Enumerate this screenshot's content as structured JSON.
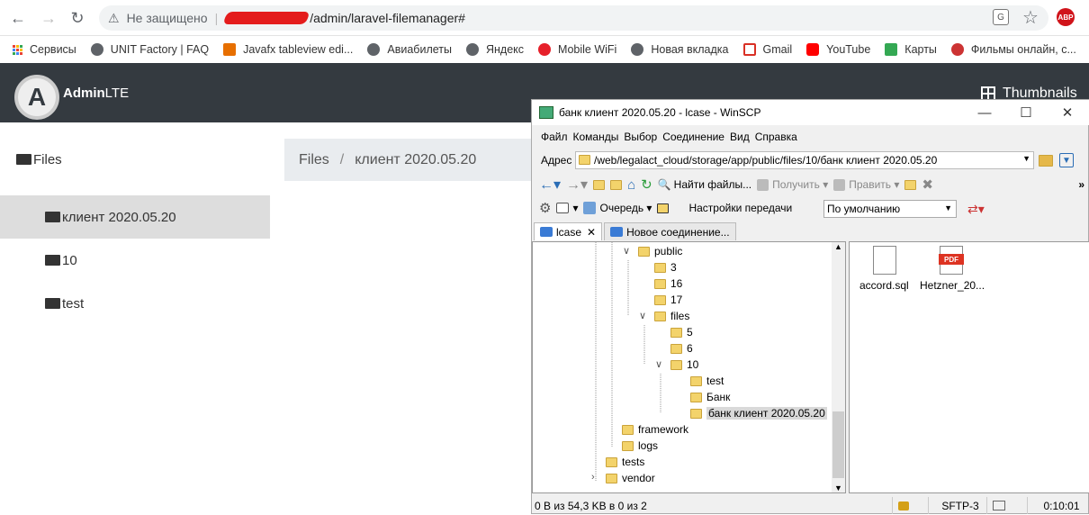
{
  "browser": {
    "security_label": "Не защищено",
    "url_suffix": "/admin/laravel-filemanager#",
    "translate_icon": "translate-icon",
    "star_icon": "star-icon",
    "abp_label": "ABP"
  },
  "bookmarks": [
    {
      "label": "Сервисы",
      "icon": "apps-icon"
    },
    {
      "label": "UNIT Factory | FAQ",
      "icon": "globe-icon"
    },
    {
      "label": "Javafx tableview edi...",
      "icon": "java-icon"
    },
    {
      "label": "Авиабилеты",
      "icon": "globe-icon"
    },
    {
      "label": "Яндекс",
      "icon": "globe-icon"
    },
    {
      "label": "Mobile WiFi",
      "icon": "huawei-icon"
    },
    {
      "label": "Новая вкладка",
      "icon": "globe-icon"
    },
    {
      "label": "Gmail",
      "icon": "gmail-icon"
    },
    {
      "label": "YouTube",
      "icon": "youtube-icon"
    },
    {
      "label": "Карты",
      "icon": "maps-icon"
    },
    {
      "label": "Фильмы онлайн, с...",
      "icon": "film-icon"
    }
  ],
  "admin": {
    "logo_letter": "A",
    "brand_bold": "Admin",
    "brand_light": "LTE",
    "thumbnails_label": "Thumbnails",
    "sidebar": [
      {
        "label": "Files"
      },
      {
        "label": "клиент 2020.05.20"
      },
      {
        "label": "10"
      },
      {
        "label": "test"
      }
    ],
    "breadcrumb": {
      "root": "Files",
      "sep": "/",
      "current": "клиент 2020.05.20"
    }
  },
  "winscp": {
    "title": "банк клиент 2020.05.20 - lcase - WinSCP",
    "menu": [
      "Файл",
      "Команды",
      "Выбор",
      "Соединение",
      "Вид",
      "Справка"
    ],
    "address_label": "Адрес",
    "address_value": "/web/legalact_cloud/storage/app/public/files/10/банк клиент 2020.05.20",
    "find_files": "Найти файлы...",
    "download": "Получить",
    "edit": "Править",
    "queue": "Очередь",
    "transfer_settings": "Настройки передачи",
    "transfer_value": "По умолчанию",
    "tabs": [
      {
        "label": "lcase"
      },
      {
        "label": "Новое соединение..."
      }
    ],
    "tree": [
      {
        "label": "public"
      },
      {
        "label": "3"
      },
      {
        "label": "16"
      },
      {
        "label": "17"
      },
      {
        "label": "files"
      },
      {
        "label": "5"
      },
      {
        "label": "6"
      },
      {
        "label": "10"
      },
      {
        "label": "test"
      },
      {
        "label": "Банк"
      },
      {
        "label": "банк клиент 2020.05.20"
      },
      {
        "label": "framework"
      },
      {
        "label": "logs"
      },
      {
        "label": "tests"
      },
      {
        "label": "vendor"
      }
    ],
    "files": [
      {
        "label": "accord.sql",
        "icon": "sql-file-icon"
      },
      {
        "label": "Hetzner_20...",
        "icon": "pdf-file-icon",
        "tag": "PDF"
      }
    ],
    "status": {
      "summary": "0 B из 54,3 KB в 0 из 2",
      "protocol": "SFTP-3",
      "time": "0:10:01"
    }
  }
}
